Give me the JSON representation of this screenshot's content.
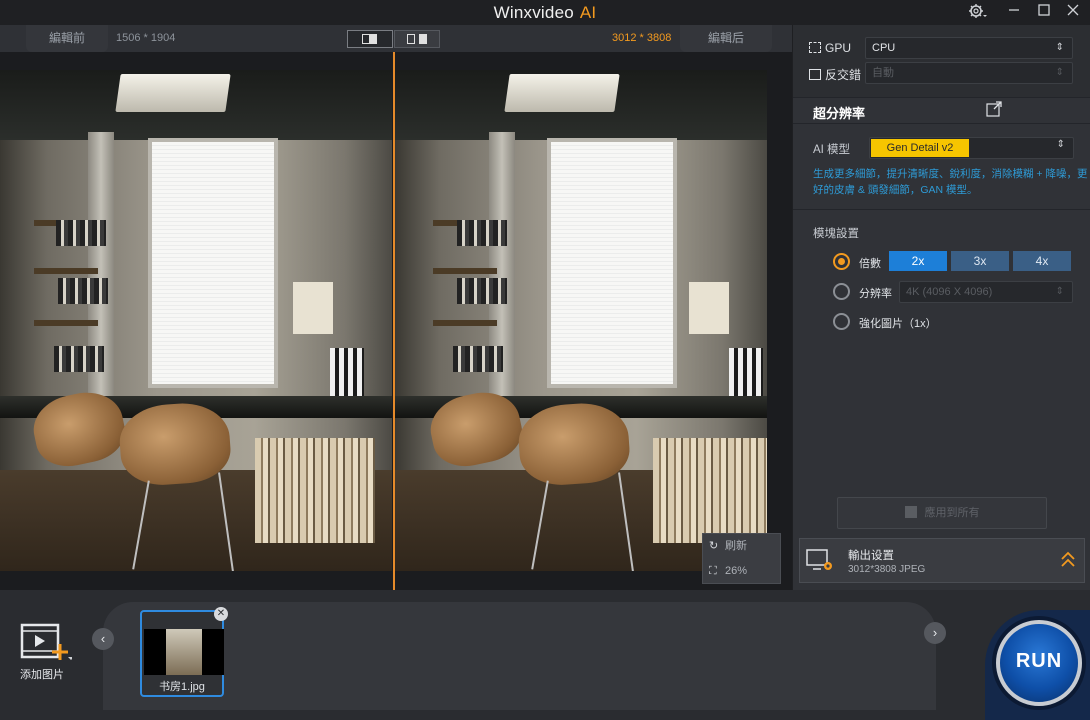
{
  "app": {
    "title": "Winxvideo",
    "title_ai": "AI"
  },
  "compare": {
    "before_label": "編輯前",
    "before_resolution": "1506 * 1904",
    "after_label": "編輯后",
    "after_resolution": "3012 * 3808"
  },
  "viewer_controls": {
    "refresh_label": "刷新",
    "zoom_label": "26%"
  },
  "hardware": {
    "gpu_label": "GPU",
    "gpu_value": "CPU",
    "interlace_label": "反交錯",
    "interlace_value": "自動"
  },
  "super_resolution": {
    "title": "超分辨率",
    "ai_model_label": "AI 模型",
    "ai_model_value": "Gen Detail v2",
    "description": "生成更多細節，提升清晰度、銳利度，消除模糊 + 降噪，更好的皮膚 & 頭發細節，GAN 模型。"
  },
  "module_settings": {
    "title": "模塊設置",
    "scale_label": "倍數",
    "scales": [
      "2x",
      "3x",
      "4x"
    ],
    "resolution_label": "分辨率",
    "resolution_value": "4K (4096 X 4096)",
    "enhance_label": "強化圖片（1x）"
  },
  "apply_all_label": "應用到所有",
  "output": {
    "title": "輸出设置",
    "detail": "3012*3808  JPEG"
  },
  "bottom": {
    "add_image_label": "添加图片",
    "thumbnail_name": "书房1.jpg",
    "run_label": "RUN"
  },
  "colors": {
    "accent": "#f39a1f",
    "selected_blue": "#1d7fd8",
    "model_chip": "#f6c500",
    "description_blue": "#2e9bd6"
  }
}
